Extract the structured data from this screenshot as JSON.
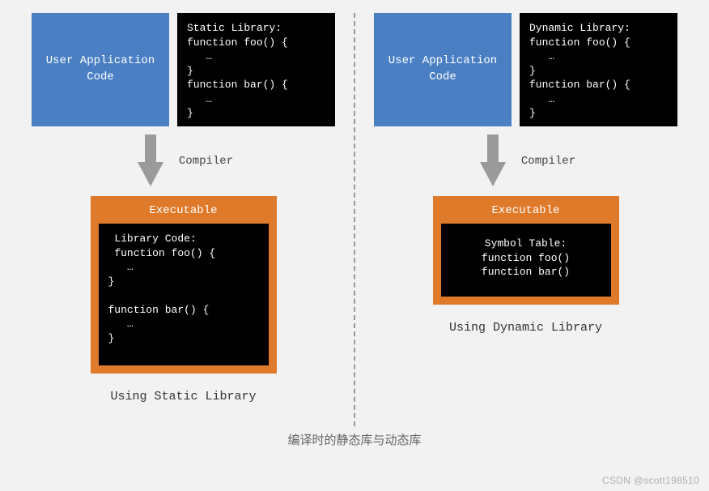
{
  "left": {
    "user_app": "User Application\nCode",
    "library_title": "Static Library:",
    "library_code": "function foo() {\n   …\n}\nfunction bar() {\n   …\n}",
    "arrow_label": "Compiler",
    "exec_title": "Executable",
    "exec_header": "Library Code:",
    "exec_code": "function foo() {\n   …\n}\n\nfunction bar() {\n   …\n}",
    "caption": "Using Static Library"
  },
  "right": {
    "user_app": "User Application\nCode",
    "library_title": "Dynamic Library:",
    "library_code": "function foo() {\n   …\n}\nfunction bar() {\n   …\n}",
    "arrow_label": "Compiler",
    "exec_title": "Executable",
    "exec_header": "Symbol Table:",
    "exec_line1": "function foo()",
    "exec_line2": "function bar()",
    "caption": "Using Dynamic Library"
  },
  "bottom_caption": "编译时的静态库与动态库",
  "watermark": "CSDN @scott198510"
}
